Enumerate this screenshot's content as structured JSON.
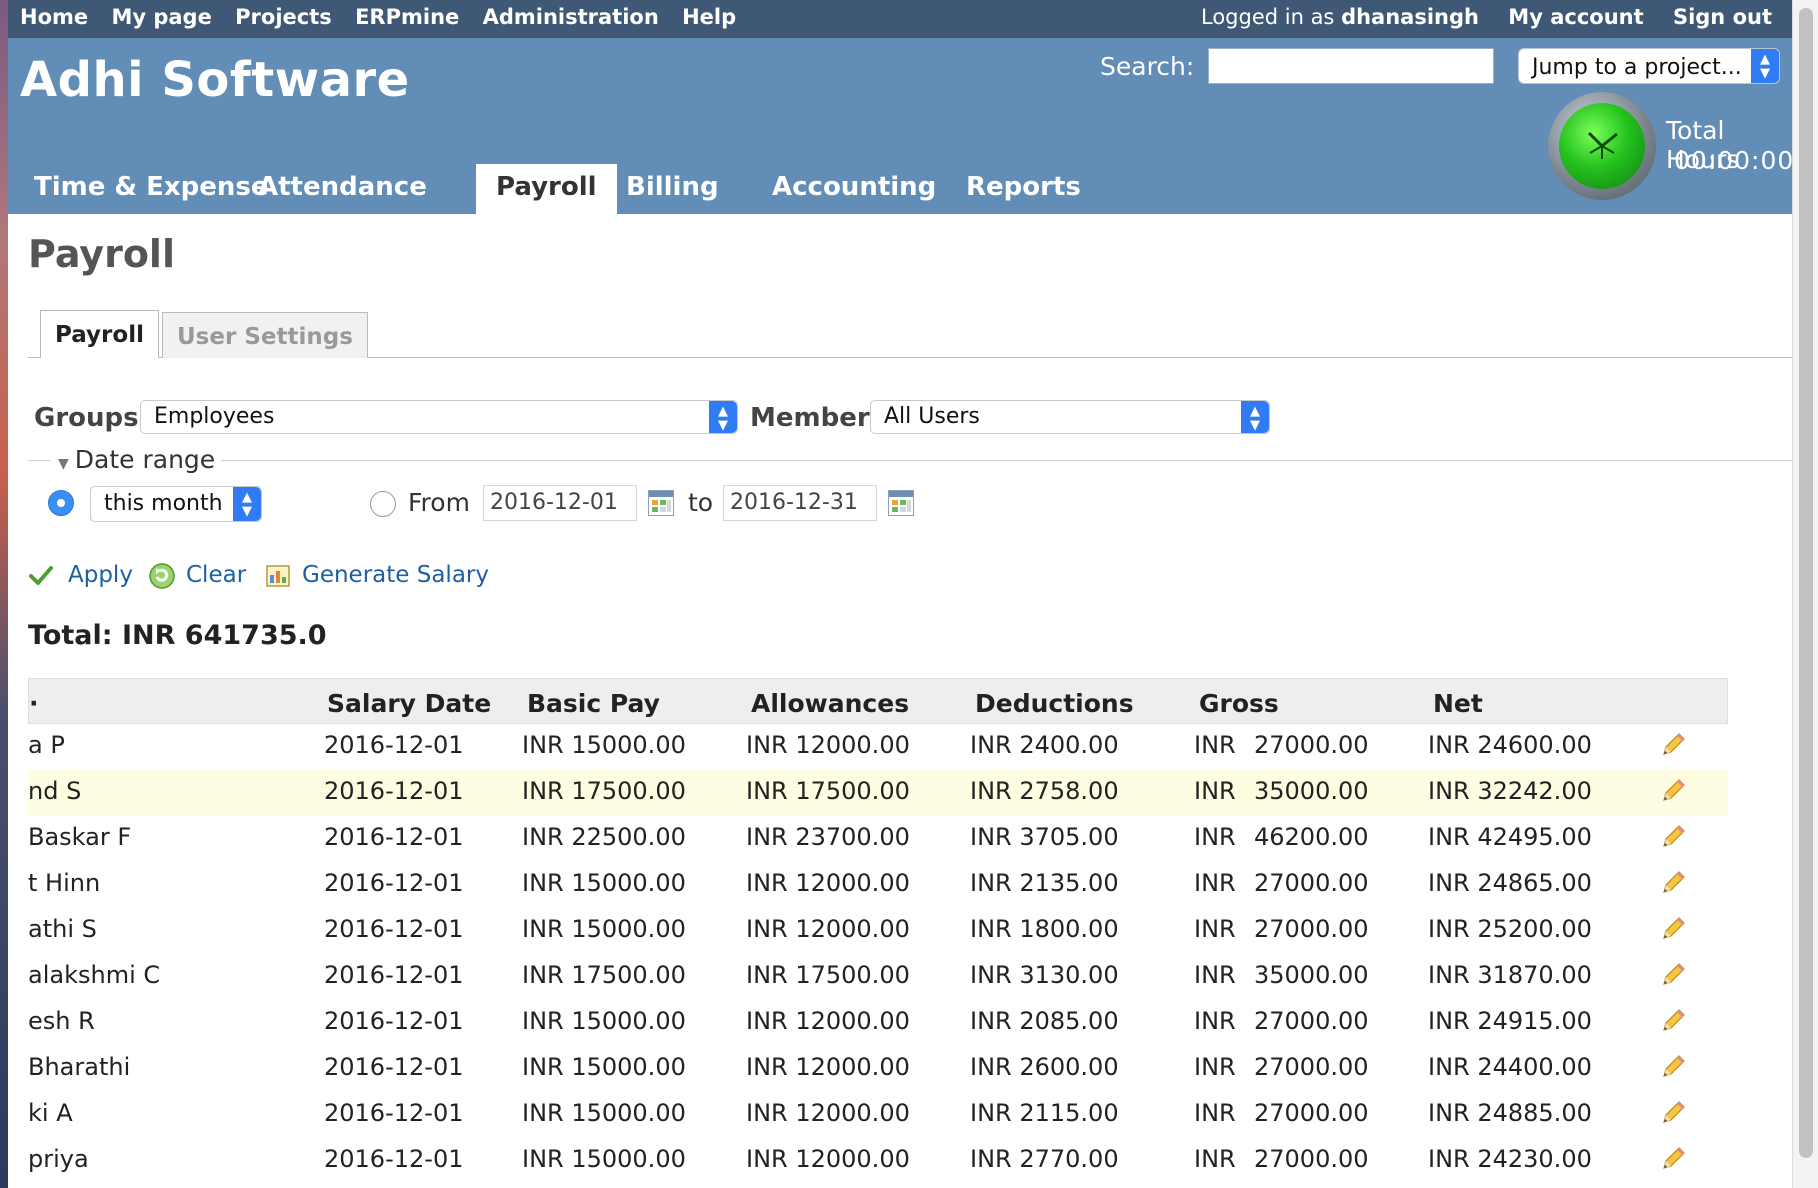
{
  "topnav": {
    "left": [
      "Home",
      "My page",
      "Projects",
      "ERPmine",
      "Administration",
      "Help"
    ],
    "logged_prefix": "Logged in as",
    "username": "dhanasingh",
    "my_account": "My account",
    "sign_out": "Sign out"
  },
  "header": {
    "app_title": "Adhi Software",
    "search_label": "Search:",
    "search_value": "",
    "jump_label": "Jump to a project...",
    "total_hours_label": "Total Hours",
    "total_hours_value": "00:00:00"
  },
  "main_tabs": [
    "Time & Expense",
    "Attendance",
    "Payroll",
    "Billing",
    "Accounting",
    "Reports"
  ],
  "main_tabs_active": "Payroll",
  "page_title": "Payroll",
  "sub_tabs": [
    "Payroll",
    "User Settings"
  ],
  "filters": {
    "groups_label": "Groups",
    "groups_value": "Employees",
    "member_label": "Member",
    "member_value": "All Users",
    "date_range_label": "Date range",
    "period_value": "this month",
    "from_label": "From",
    "from_date": "2016-12-01",
    "to_label": "to",
    "to_date": "2016-12-31"
  },
  "actions": {
    "apply": "Apply",
    "clear": "Clear",
    "generate": "Generate Salary"
  },
  "total": "Total: INR 641735.0",
  "table": {
    "columns": [
      "·",
      "Salary Date",
      "Basic Pay",
      "Allowances",
      "Deductions",
      "Gross",
      "Net"
    ],
    "rows": [
      {
        "name": "a P",
        "date": "2016-12-01",
        "basic": "INR 15000.00",
        "allow": "INR 12000.00",
        "deduct": "INR 2400.00",
        "gross_cur": "INR",
        "gross": "27000.00",
        "net": "INR 24600.00"
      },
      {
        "name": "nd S",
        "date": "2016-12-01",
        "basic": "INR 17500.00",
        "allow": "INR 17500.00",
        "deduct": "INR 2758.00",
        "gross_cur": "INR",
        "gross": "35000.00",
        "net": "INR 32242.00"
      },
      {
        "name": "Baskar F",
        "date": "2016-12-01",
        "basic": "INR 22500.00",
        "allow": "INR 23700.00",
        "deduct": "INR 3705.00",
        "gross_cur": "INR",
        "gross": "46200.00",
        "net": "INR 42495.00"
      },
      {
        "name": "t Hinn",
        "date": "2016-12-01",
        "basic": "INR 15000.00",
        "allow": "INR 12000.00",
        "deduct": "INR 2135.00",
        "gross_cur": "INR",
        "gross": "27000.00",
        "net": "INR 24865.00"
      },
      {
        "name": "athi S",
        "date": "2016-12-01",
        "basic": "INR 15000.00",
        "allow": "INR 12000.00",
        "deduct": "INR 1800.00",
        "gross_cur": "INR",
        "gross": "27000.00",
        "net": "INR 25200.00"
      },
      {
        "name": "alakshmi C",
        "date": "2016-12-01",
        "basic": "INR 17500.00",
        "allow": "INR 17500.00",
        "deduct": "INR 3130.00",
        "gross_cur": "INR",
        "gross": "35000.00",
        "net": "INR 31870.00"
      },
      {
        "name": "esh R",
        "date": "2016-12-01",
        "basic": "INR 15000.00",
        "allow": "INR 12000.00",
        "deduct": "INR 2085.00",
        "gross_cur": "INR",
        "gross": "27000.00",
        "net": "INR 24915.00"
      },
      {
        "name": "Bharathi",
        "date": "2016-12-01",
        "basic": "INR 15000.00",
        "allow": "INR 12000.00",
        "deduct": "INR 2600.00",
        "gross_cur": "INR",
        "gross": "27000.00",
        "net": "INR 24400.00"
      },
      {
        "name": "ki A",
        "date": "2016-12-01",
        "basic": "INR 15000.00",
        "allow": "INR 12000.00",
        "deduct": "INR 2115.00",
        "gross_cur": "INR",
        "gross": "27000.00",
        "net": "INR 24885.00"
      },
      {
        "name": "priya",
        "date": "2016-12-01",
        "basic": "INR 15000.00",
        "allow": "INR 12000.00",
        "deduct": "INR 2770.00",
        "gross_cur": "INR",
        "gross": "27000.00",
        "net": "INR 24230.00"
      }
    ],
    "highlighted_row": 1
  },
  "colors": {
    "topbar": "#3f5875",
    "header": "#628db6",
    "link": "#1f5fa0",
    "row_highlight": "#fffde1"
  },
  "icons": {
    "apply": "checkmark-icon",
    "clear": "refresh-icon",
    "generate": "report-icon",
    "edit": "pencil-icon",
    "clock": "clock-icon",
    "calendar": "calendar-icon"
  }
}
